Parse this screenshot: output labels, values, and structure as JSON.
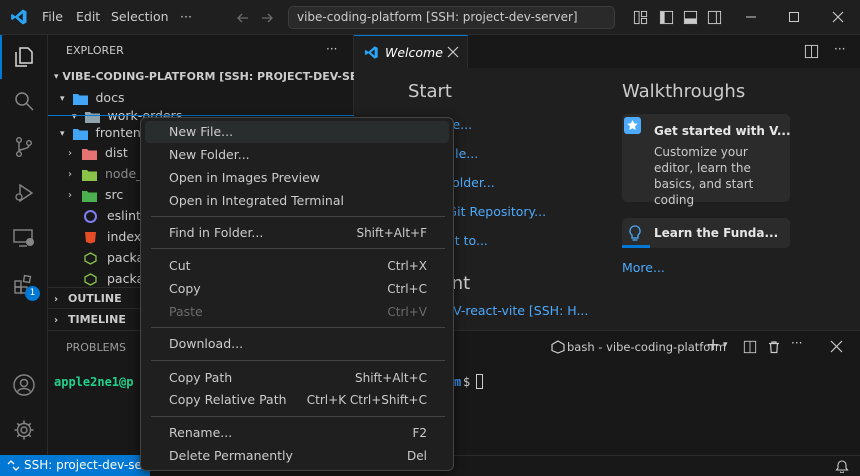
{
  "titlebar": {
    "menus": [
      "File",
      "Edit",
      "Selection"
    ],
    "more": "···",
    "command_center": "vibe-coding-platform [SSH: project-dev-server]"
  },
  "activity": {
    "extensions_badge": "1"
  },
  "sidebar": {
    "title": "EXPLORER",
    "more": "···",
    "root": "VIBE-CODING-PLATFORM [SSH: PROJECT-DEV-SERVER]",
    "items": [
      {
        "label": "docs"
      },
      {
        "label": "work-orders"
      },
      {
        "label": "frontend"
      },
      {
        "label": "dist"
      },
      {
        "label": "node_m"
      },
      {
        "label": "src"
      },
      {
        "label": "eslint.c"
      },
      {
        "label": "index.h"
      },
      {
        "label": "packag"
      },
      {
        "label": "packag"
      }
    ],
    "outline": "OUTLINE",
    "timeline": "TIMELINE"
  },
  "editor": {
    "tab_label": "Welcome",
    "start_heading": "Start",
    "start_links": [
      "New File...",
      "Open File...",
      "Open Folder...",
      "Clone Git Repository...",
      "Connect to..."
    ],
    "recent_heading": "Recent",
    "recent_item": "V-react-vite [SSH: H...",
    "walkthroughs_heading": "Walkthroughs",
    "walk1_title": "Get started with V...",
    "walk1_desc": "Customize your editor, learn the basics, and start coding",
    "walk2_title": "Learn the Funda...",
    "more_link": "More..."
  },
  "panel": {
    "problems_tab": "PROBLEMS",
    "terminal_name": "bash - vibe-coding-platform",
    "prompt_user": "apple2ne1@p",
    "prompt_tail": "m",
    "prompt_symbol": "$"
  },
  "status": {
    "remote": "SSH: project-dev-server"
  },
  "context_menu": {
    "items": [
      {
        "label": "New File...",
        "shortcut": "",
        "highlighted": true
      },
      {
        "label": "New Folder...",
        "shortcut": ""
      },
      {
        "label": "Open in Images Preview",
        "shortcut": ""
      },
      {
        "label": "Open in Integrated Terminal",
        "shortcut": ""
      },
      {
        "label": "Find in Folder...",
        "shortcut": "Shift+Alt+F"
      },
      {
        "label": "Cut",
        "shortcut": "Ctrl+X"
      },
      {
        "label": "Copy",
        "shortcut": "Ctrl+C"
      },
      {
        "label": "Paste",
        "shortcut": "Ctrl+V",
        "disabled": true
      },
      {
        "label": "Download...",
        "shortcut": ""
      },
      {
        "label": "Copy Path",
        "shortcut": "Shift+Alt+C"
      },
      {
        "label": "Copy Relative Path",
        "shortcut": "Ctrl+K Ctrl+Shift+C"
      },
      {
        "label": "Rename...",
        "shortcut": "F2"
      },
      {
        "label": "Delete Permanently",
        "shortcut": "Del"
      }
    ]
  },
  "colors": {
    "accent": "#0078d4",
    "link": "#4daafc",
    "background": "#1f1f1f",
    "sidebar": "#181818",
    "terminal_green": "#23d18b"
  }
}
